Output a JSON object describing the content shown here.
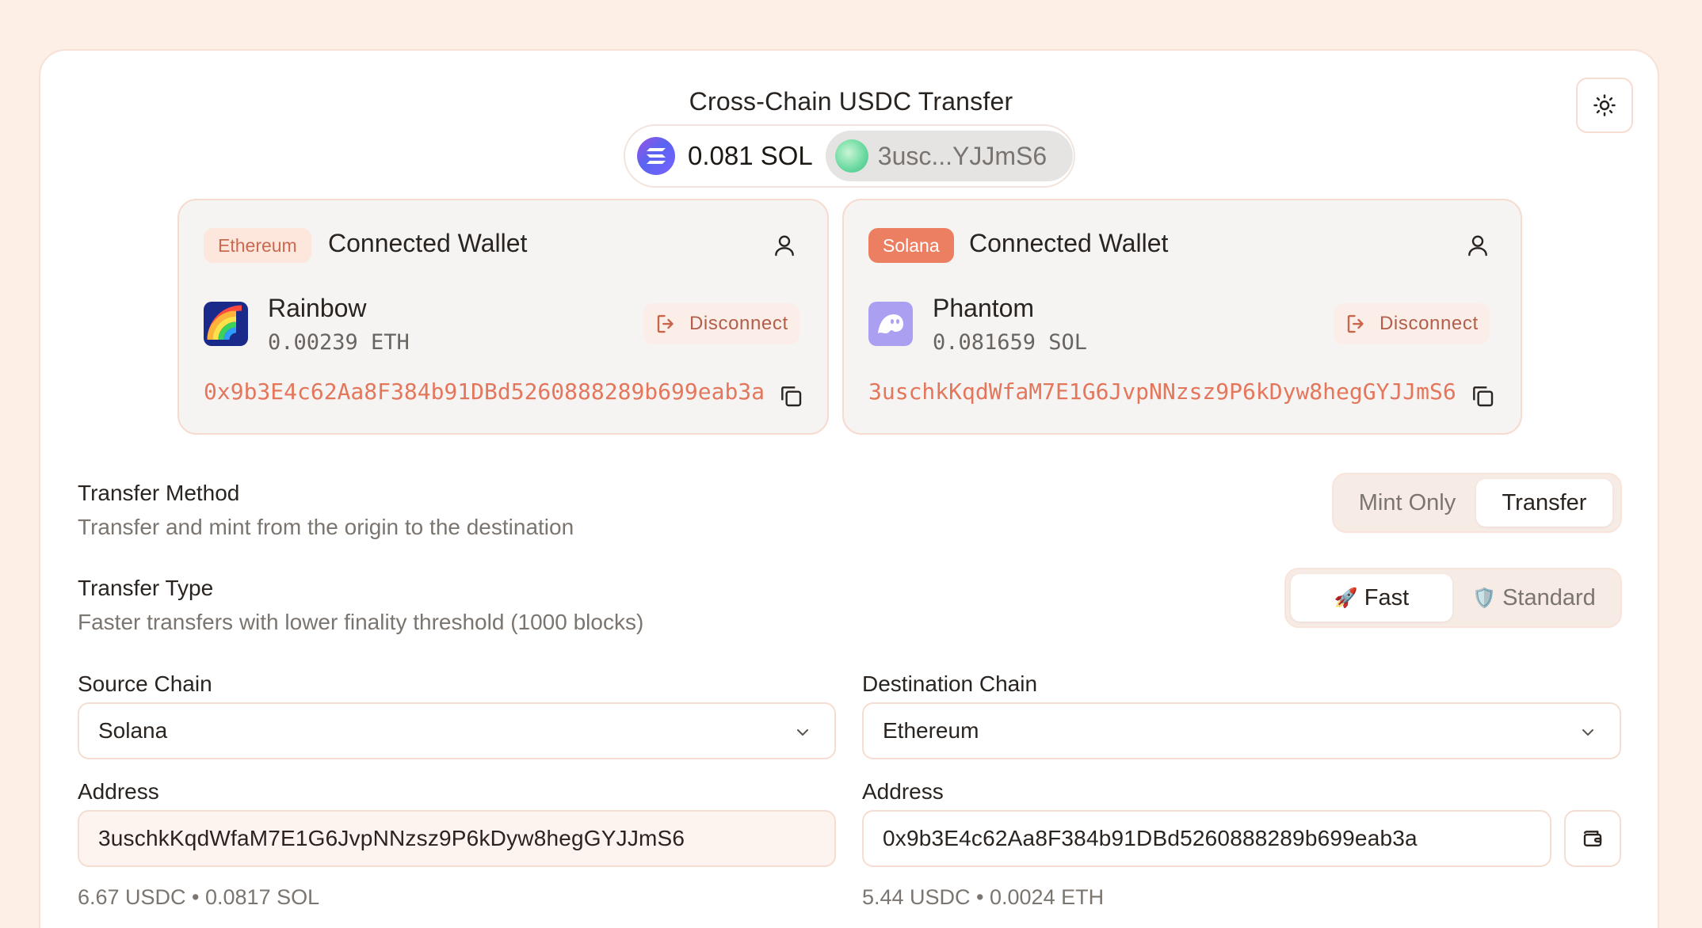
{
  "header": {
    "title": "Cross-Chain USDC Transfer",
    "balance": "0.081 SOL",
    "account_short": "3usc...YJJmS6"
  },
  "wallets": {
    "ethereum": {
      "chain_badge": "Ethereum",
      "title": "Connected Wallet",
      "name": "Rainbow",
      "balance": "0.00239 ETH",
      "disconnect_label": "Disconnect",
      "address": "0x9b3E4c62Aa8F384b91DBd5260888289b699eab3a"
    },
    "solana": {
      "chain_badge": "Solana",
      "title": "Connected Wallet",
      "name": "Phantom",
      "balance": "0.081659 SOL",
      "disconnect_label": "Disconnect",
      "address": "3uschkKqdWfaM7E1G6JvpNNzsz9P6kDyw8hegGYJJmS6"
    }
  },
  "transfer_method": {
    "label": "Transfer Method",
    "description": "Transfer and mint from the origin to the destination",
    "options": [
      "Mint Only",
      "Transfer"
    ],
    "selected": "Transfer"
  },
  "transfer_type": {
    "label": "Transfer Type",
    "description": "Faster transfers with lower finality threshold (1000 blocks)",
    "options": [
      {
        "emoji": "🚀",
        "label": "Fast"
      },
      {
        "emoji": "🛡️",
        "label": "Standard"
      }
    ],
    "selected": "Fast"
  },
  "source": {
    "chain_label": "Source Chain",
    "chain_value": "Solana",
    "address_label": "Address",
    "address_value": "3uschkKqdWfaM7E1G6JvpNNzsz9P6kDyw8hegGYJJmS6",
    "balances": "6.67 USDC • 0.0817 SOL"
  },
  "destination": {
    "chain_label": "Destination Chain",
    "chain_value": "Ethereum",
    "address_label": "Address",
    "address_value": "0x9b3E4c62Aa8F384b91DBd5260888289b699eab3a",
    "balances": "5.44 USDC • 0.0024 ETH"
  },
  "colors": {
    "page_bg": "#fdeee6",
    "accent": "#e3765b",
    "solana_badge": "#ec7f62"
  },
  "icons": {
    "theme": "sun-icon",
    "user": "user-icon",
    "disconnect": "logout-icon",
    "copy": "copy-icon",
    "chevron": "chevron-down-icon",
    "wallet": "wallet-icon"
  }
}
